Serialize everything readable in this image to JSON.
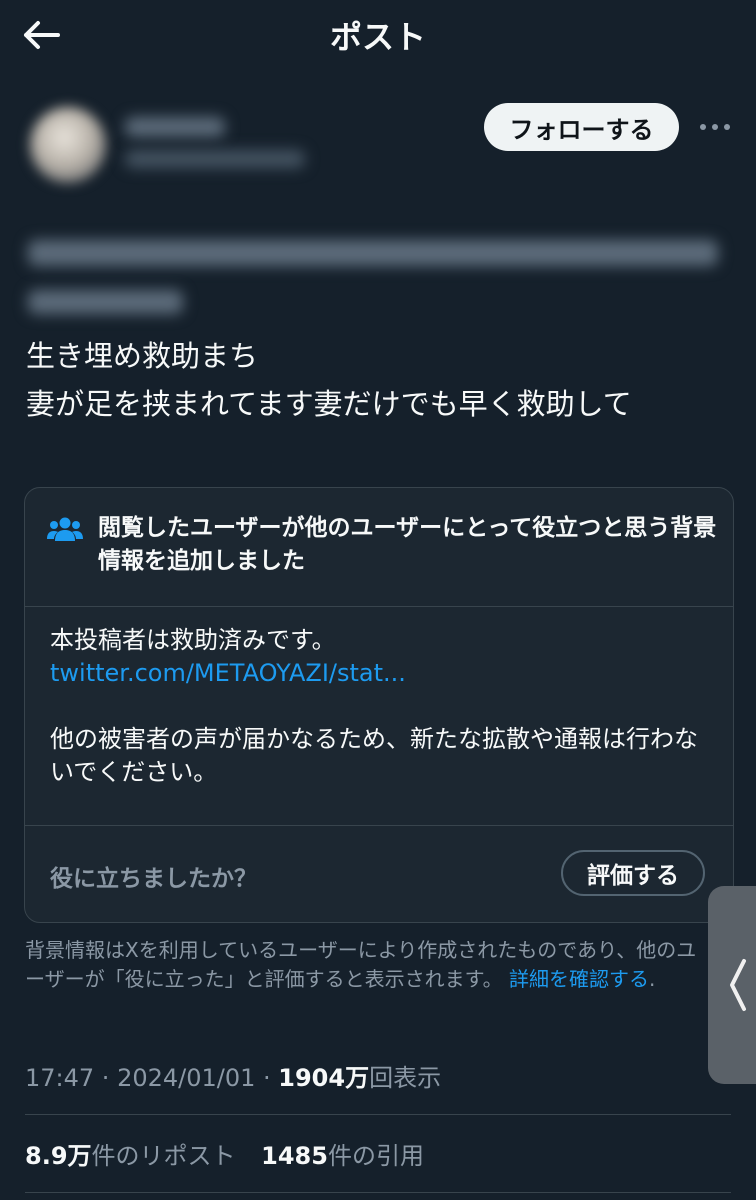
{
  "header": {
    "title": "ポスト"
  },
  "author": {
    "follow_label": "フォローする"
  },
  "post": {
    "line1": "生き埋め救助まち",
    "line2": "妻が足を挟まれてます妻だけでも早く救助して"
  },
  "community_note": {
    "header": "閲覧したユーザーが他のユーザーにとって役立つと思う背景情報を追加しました",
    "body_line1": "本投稿者は救助済みです。",
    "link": "twitter.com/METAOYAZI/stat...",
    "body_line2": "他の被害者の声が届かなるため、新たな拡散や通報は行わないでください。",
    "helpful_question": "役に立ちましたか？",
    "rate_label": "評価する"
  },
  "disclaimer": {
    "text": "背景情報はXを利用しているユーザーにより作成されたものであり、他のユーザーが「役に立った」と評価すると表示されます。",
    "link": "詳細を確認する",
    "period": "."
  },
  "meta": {
    "time": "17:47",
    "sep1": " · ",
    "date": "2024/01/01",
    "sep2": " · ",
    "views_count": "1904万",
    "views_label": "回表示"
  },
  "stats": {
    "reposts_count": "8.9万",
    "reposts_label": "件のリポスト",
    "quotes_count": "1485",
    "quotes_label": "件の引用"
  },
  "colors": {
    "background": "#15202b",
    "card": "#1c2731",
    "border": "#38444d",
    "link": "#1d9bf0",
    "muted": "#8b98a5"
  },
  "icons": {
    "back": "arrow-left-icon",
    "more": "more-horizontal-icon",
    "note": "people-icon",
    "side": "chevron-left-icon"
  }
}
